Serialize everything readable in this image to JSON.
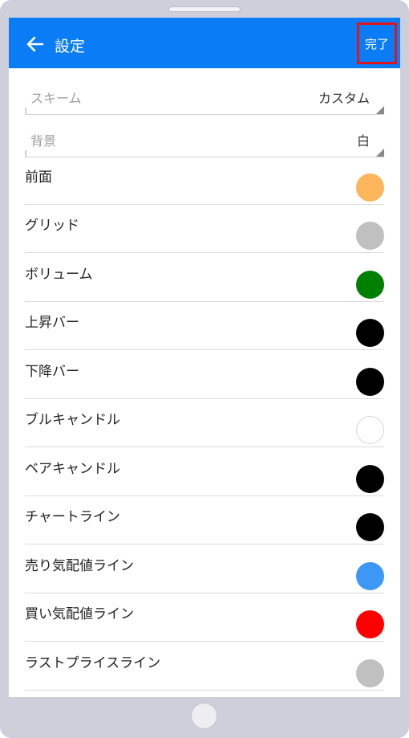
{
  "header": {
    "title": "設定",
    "done_label": "完了"
  },
  "selects": [
    {
      "label": "スキーム",
      "value": "カスタム"
    },
    {
      "label": "背景",
      "value": "白"
    }
  ],
  "color_items": [
    {
      "label": "前面",
      "color": "#fcb55a"
    },
    {
      "label": "グリッド",
      "color": "#c0c0c0"
    },
    {
      "label": "ボリューム",
      "color": "#008000"
    },
    {
      "label": "上昇バー",
      "color": "#000000"
    },
    {
      "label": "下降バー",
      "color": "#000000"
    },
    {
      "label": "ブルキャンドル",
      "color": "#ffffff"
    },
    {
      "label": "ベアキャンドル",
      "color": "#000000"
    },
    {
      "label": "チャートライン",
      "color": "#000000"
    },
    {
      "label": "売り気配値ライン",
      "color": "#3d97f5"
    },
    {
      "label": "買い気配値ライン",
      "color": "#ff0000"
    },
    {
      "label": "ラストプライスライン",
      "color": "#c0c0c0"
    }
  ]
}
